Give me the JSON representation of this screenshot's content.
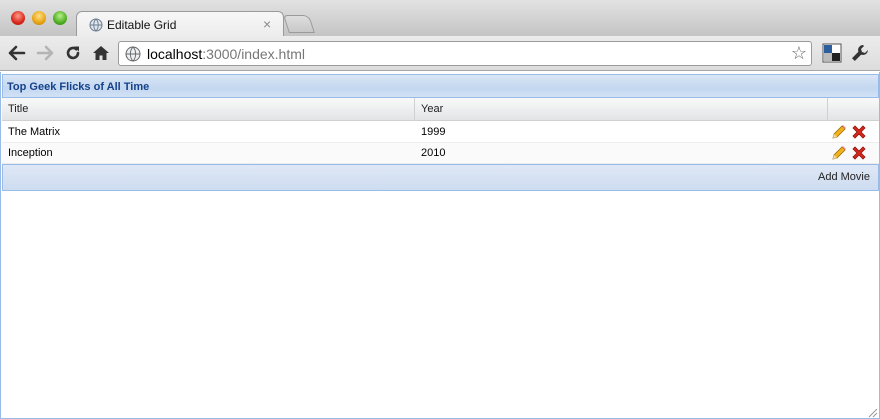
{
  "browser": {
    "tab_title": "Editable Grid",
    "tab_close": "×",
    "url_host": "localhost",
    "url_path": ":3000/index.html",
    "icons": {
      "back": "back-arrow-icon",
      "forward": "forward-arrow-icon",
      "reload": "reload-icon",
      "home": "home-icon",
      "bookmark": "star-icon",
      "page_action": "page-action-icon",
      "wrench": "wrench-icon"
    }
  },
  "panel": {
    "title": "Top Geek Flicks of All Time"
  },
  "grid": {
    "columns": [
      "Title",
      "Year",
      ""
    ],
    "rows": [
      {
        "title": "The Matrix",
        "year": "1999"
      },
      {
        "title": "Inception",
        "year": "2010"
      }
    ],
    "row_actions": [
      "pencil-edit-icon",
      "red-x-delete-icon"
    ]
  },
  "footer": {
    "add_label": "Add Movie"
  },
  "colors": {
    "panel_title": "#15428b",
    "panel_border": "#99bbe8",
    "delete": "#d8281b",
    "edit": "#e8a410"
  }
}
